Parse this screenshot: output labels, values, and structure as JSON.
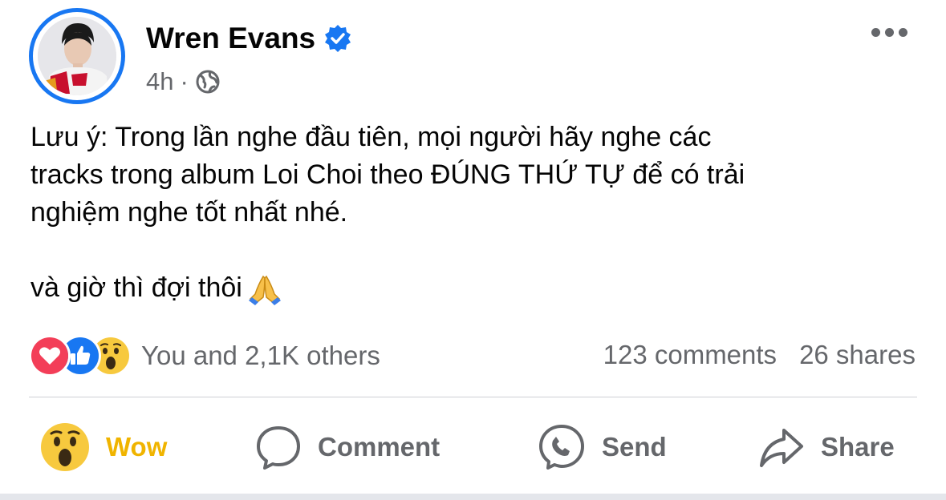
{
  "post": {
    "author": "Wren Evans",
    "time": "4h",
    "separator": "·",
    "body_lines": [
      "Lưu ý: Trong lần nghe đầu tiên, mọi người hãy nghe các",
      "tracks trong album Loi Choi theo ĐÚNG THỨ TỰ để có trải",
      "nghiệm nghe tốt nhất nhé."
    ],
    "body_line_2": "và giờ thì đợi thôi"
  },
  "reactions": {
    "summary": "You and 2,1K others",
    "comments": "123 comments",
    "shares": "26 shares"
  },
  "actions": {
    "wow_label": "Wow",
    "comment_label": "Comment",
    "send_label": "Send",
    "share_label": "Share"
  },
  "colors": {
    "accent": "#1877f2",
    "wow": "#f0b400",
    "muted": "#65676b"
  }
}
